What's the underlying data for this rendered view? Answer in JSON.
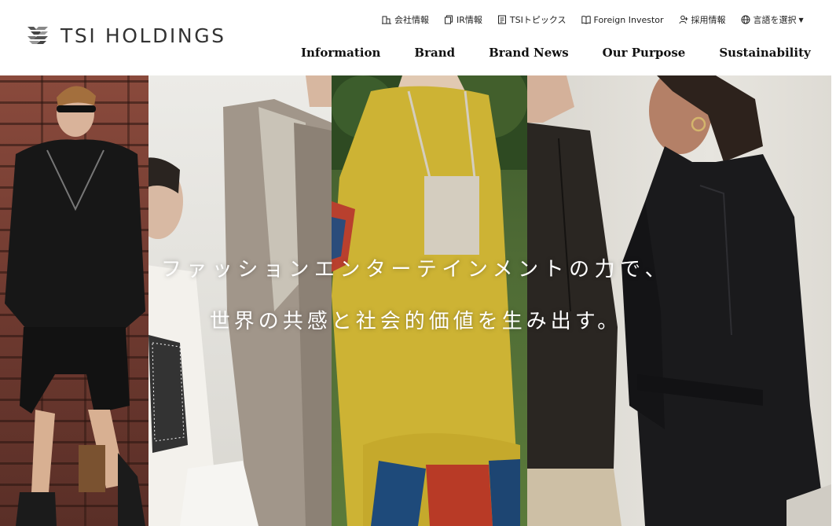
{
  "brand": {
    "name": "TSI HOLDINGS"
  },
  "utility_nav": [
    {
      "label": "会社情報",
      "icon": "building-icon"
    },
    {
      "label": "IR情報",
      "icon": "document-copy-icon"
    },
    {
      "label": "TSIトピックス",
      "icon": "news-icon"
    },
    {
      "label": "Foreign Investor",
      "icon": "book-icon"
    },
    {
      "label": "採用情報",
      "icon": "person-icon"
    },
    {
      "label": "言語を選択",
      "icon": "globe-icon"
    }
  ],
  "main_nav": [
    {
      "label": "Information"
    },
    {
      "label": "Brand"
    },
    {
      "label": "Brand News"
    },
    {
      "label": "Our Purpose"
    },
    {
      "label": "Sustainability"
    }
  ],
  "hero": {
    "line1": "ファッションエンターテインメントの力で、",
    "line2": "世界の共感と社会的価値を生み出す。"
  }
}
